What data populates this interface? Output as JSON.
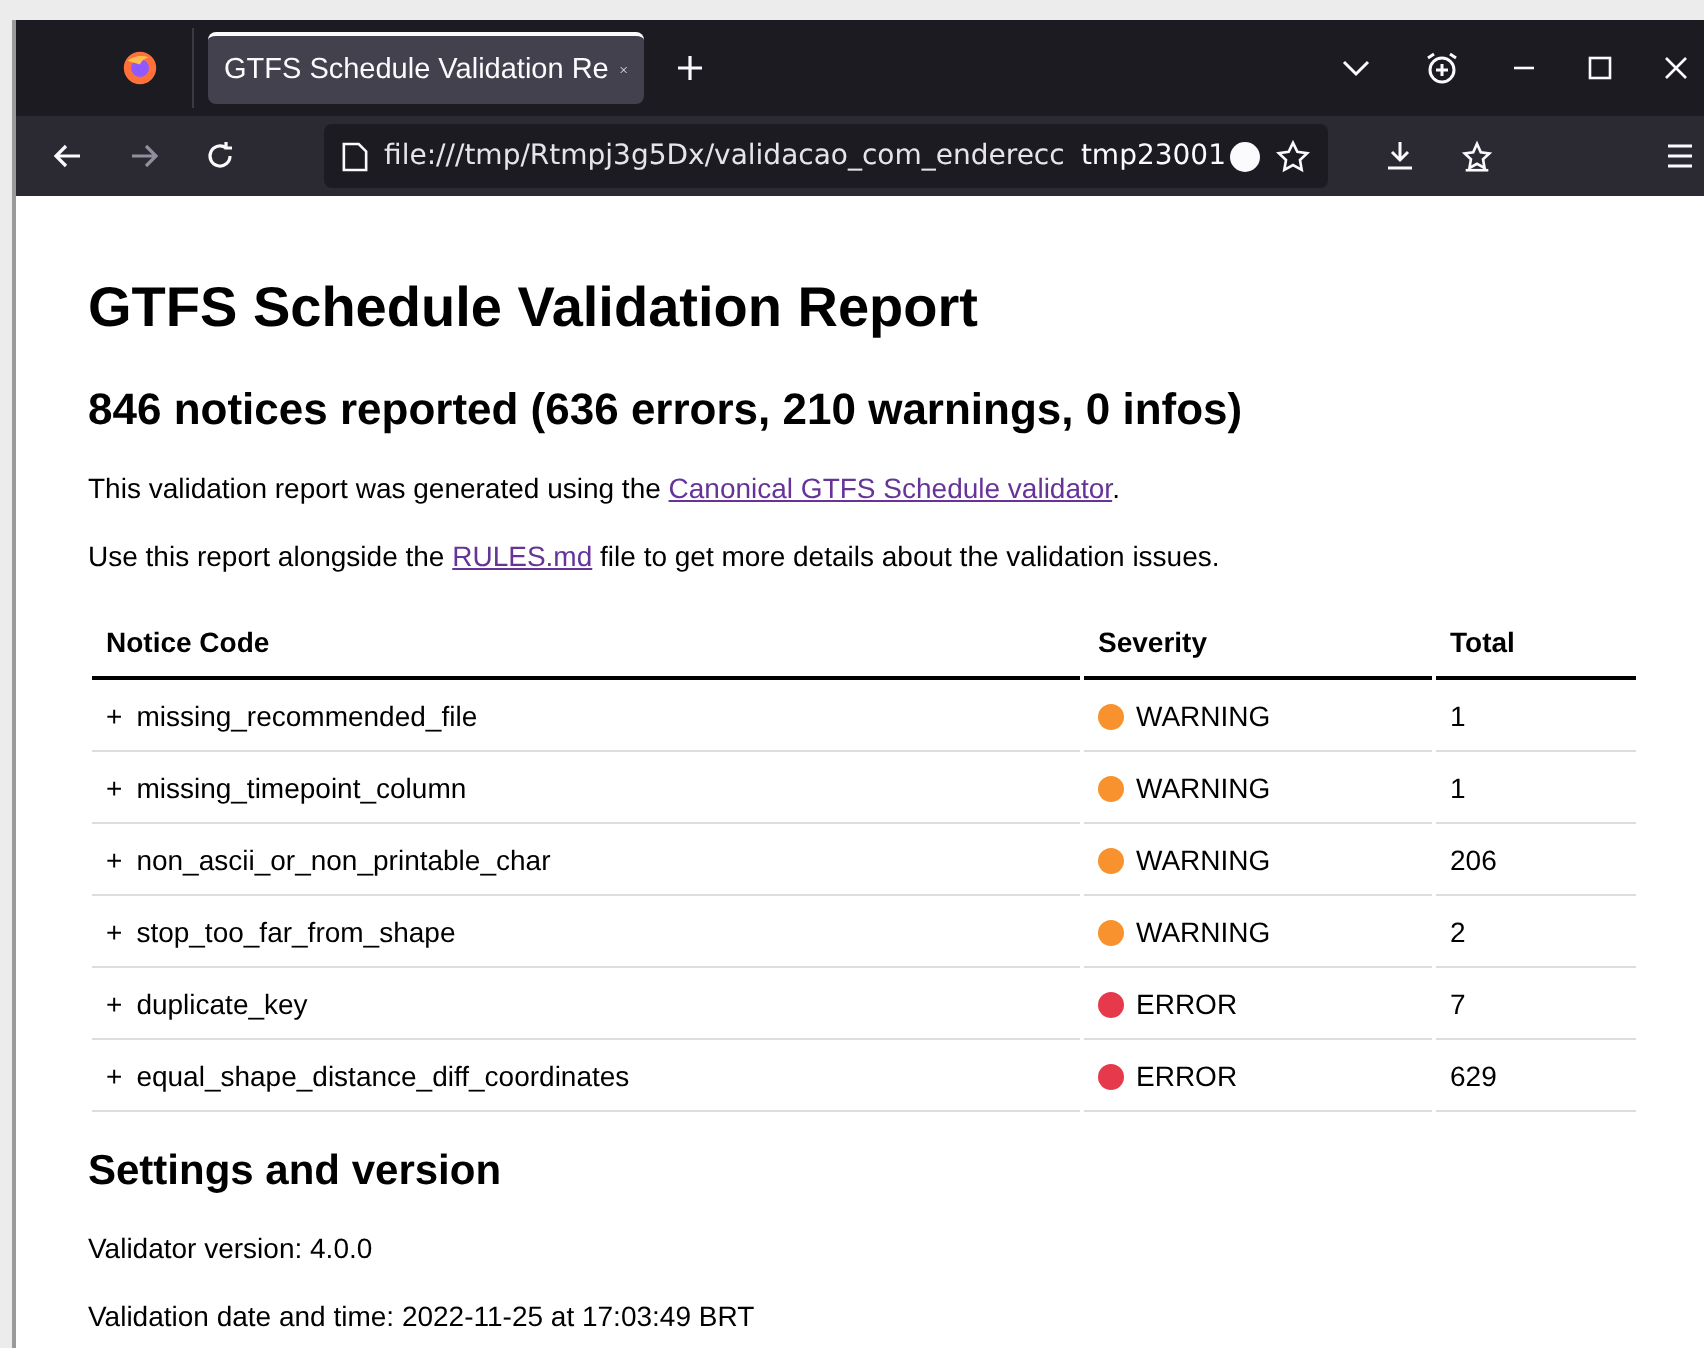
{
  "browser": {
    "tabs": [
      {
        "label": "GTFS Schedule Validation Re",
        "selected": true
      }
    ],
    "address": {
      "url": "file:///tmp/Rtmpj3g5Dx/validacao_com_enderecc",
      "extra": "tmp23001"
    }
  },
  "report": {
    "title": "GTFS Schedule Validation Report",
    "summary": "846 notices reported (636 errors, 210 warnings, 0 infos)",
    "paragraphs": [
      {
        "before": "This validation report was generated using the ",
        "link": "Canonical GTFS Schedule validator",
        "after": "."
      },
      {
        "before": "Use this report alongside the ",
        "link": "RULES.md",
        "after": " file to get more details about the validation issues."
      }
    ],
    "table": {
      "columns": [
        "Notice Code",
        "Severity",
        "Total"
      ],
      "rows": [
        {
          "expand": "+",
          "code": "missing_recommended_file",
          "severity": "WARNING",
          "color": "#f7922e",
          "total": "1"
        },
        {
          "expand": "+",
          "code": "missing_timepoint_column",
          "severity": "WARNING",
          "color": "#f7922e",
          "total": "1"
        },
        {
          "expand": "+",
          "code": "non_ascii_or_non_printable_char",
          "severity": "WARNING",
          "color": "#f7922e",
          "total": "206"
        },
        {
          "expand": "+",
          "code": "stop_too_far_from_shape",
          "severity": "WARNING",
          "color": "#f7922e",
          "total": "2"
        },
        {
          "expand": "+",
          "code": "duplicate_key",
          "severity": "ERROR",
          "color": "#e6394b",
          "total": "7"
        },
        {
          "expand": "+",
          "code": "equal_shape_distance_diff_coordinates",
          "severity": "ERROR",
          "color": "#e6394b",
          "total": "629"
        }
      ]
    },
    "settings": {
      "title": "Settings and version",
      "lines": [
        "Validator version: 4.0.0",
        "Validation date and time: 2022-11-25 at 17:03:49 BRT"
      ]
    }
  }
}
